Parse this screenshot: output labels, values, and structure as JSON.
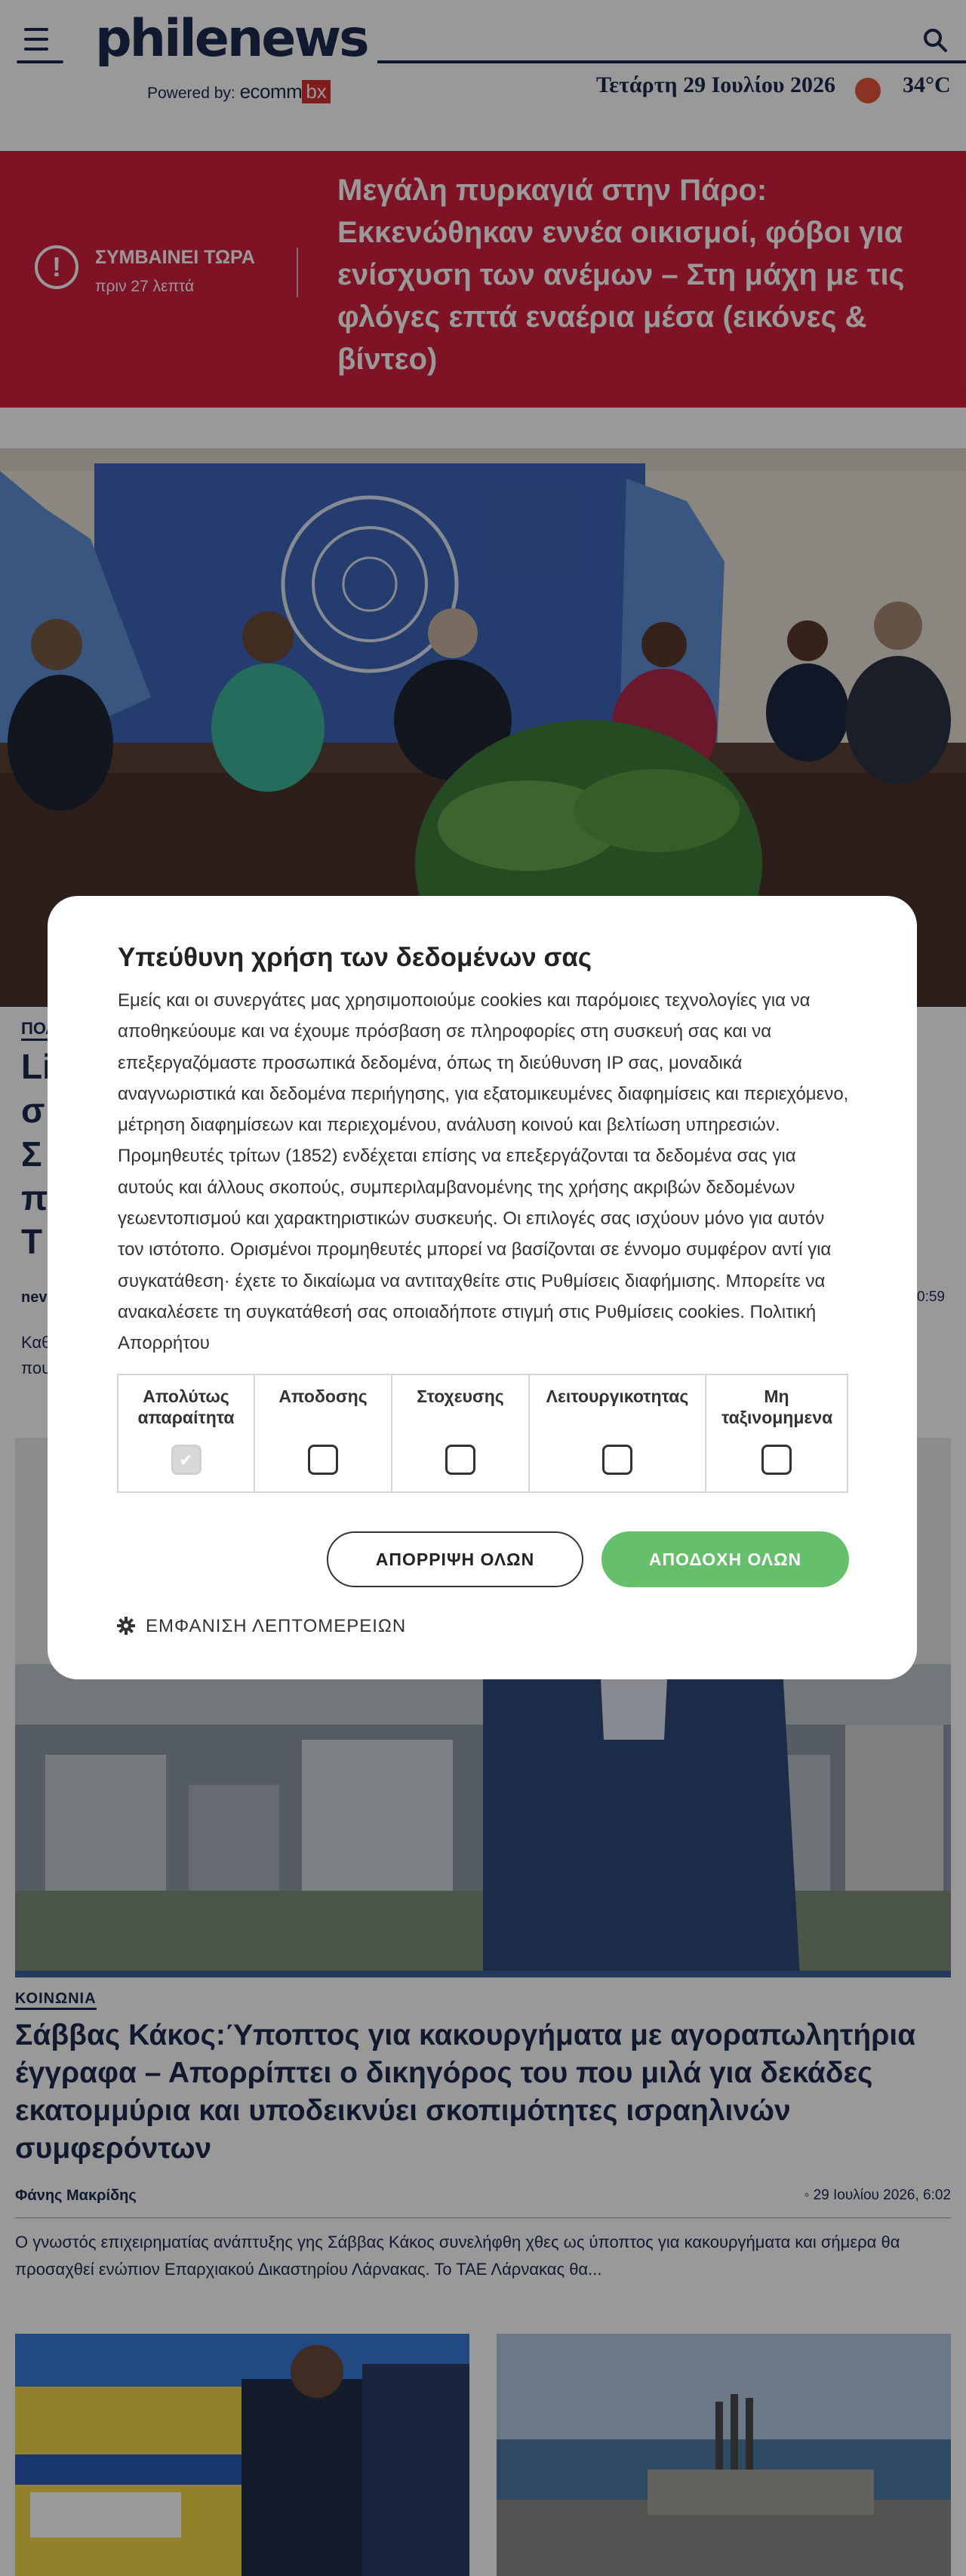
{
  "header": {
    "logo": "philenews",
    "powered_by": "Powered by:",
    "powered_brand": "ecomm",
    "powered_brand_suffix": "bx",
    "date": "Τετάρτη 29 Ιουλίου 2026",
    "temperature": "34°C",
    "icons": [
      "menu-icon",
      "search-icon",
      "weather-icon"
    ]
  },
  "breaking": {
    "label": "ΣΥΜΒΑΙΝΕΙ ΤΩΡΑ",
    "time": "πριν 27 λεπτά",
    "headline": "Μεγάλη πυρκαγιά στην Πάρο: Εκκενώθηκαν εννέα οικισμοί, φόβοι για ενίσχυση των ανέμων – Στη μάχη με τις φλόγες επτά εναέρια μέσα (εικόνες & βίντεο)",
    "accent": "#d2213f"
  },
  "article1": {
    "category": "ΠΟΛ",
    "title": "Li\nσ\nΣ\nπ\nΤ",
    "author": "nev",
    "time": "0:59",
    "excerpt": "Καθ\nπου"
  },
  "article2": {
    "category": "ΚΟΙΝΩΝΙΑ",
    "title": "Σάββας Κάκος:Ύποπτος για κακουργήματα με αγοραπωλητήρια έγγραφα – Απορρίπτει ο δικηγόρος του που μιλά για δεκάδες εκατομμύρια και υποδεικνύει σκοπιμότητες ισραηλινών συμφερόντων",
    "author": "Φάνης Μακρίδης",
    "time": "29 Ιουλίου 2026, 6:02",
    "excerpt": "Ο γνωστός επιχειρηματίας ανάπτυξης γης Σάββας Κάκος συνελήφθη χθες ως ύποπτος για κακουργήματα και σήμερα θα προσαχθεί ενώπιον Επαρχιακού Δικαστηρίου Λάρνακας. Το ΤΑΕ Λάρνακας θα..."
  },
  "cookie_modal": {
    "title": "Υπεύθυνη χρήση των δεδομένων σας",
    "body": "Εμείς και οι συνεργάτες μας χρησιμοποιούμε cookies και παρόμοιες τεχνολογίες για να αποθηκεύουμε και να έχουμε πρόσβαση σε πληροφορίες στη συσκευή σας και να επεξεργαζόμαστε προσωπικά δεδομένα, όπως τη διεύθυνση IP σας, μοναδικά αναγνωριστικά και δεδομένα περιήγησης, για εξατομικευμένες διαφημίσεις και περιεχόμενο, μέτρηση διαφημίσεων και περιεχομένου, ανάλυση κοινού και βελτίωση υπηρεσιών. Προμηθευτές τρίτων (1852) ενδέχεται επίσης να επεξεργάζονται τα δεδομένα σας για αυτούς και άλλους σκοπούς, συμπεριλαμβανομένης της χρήσης ακριβών δεδομένων γεωεντοπισμού και χαρακτηριστικών συσκευής. Οι επιλογές σας ισχύουν μόνο για αυτόν τον ιστότοπο. Ορισμένοι προμηθευτές μπορεί να βασίζονται σε έννομο συμφέρον αντί για συγκατάθεση· έχετε το δικαίωμα να αντιταχθείτε στις Ρυθμίσεις διαφήμισης. Μπορείτε να ανακαλέσετε τη συγκατάθεσή σας οποιαδήποτε στιγμή στις Ρυθμίσεις cookies.",
    "policy_link": "Πολιτική Απορρήτου",
    "categories": [
      {
        "label": "Απολύτως απαραίτητα",
        "checked": true
      },
      {
        "label": "Αποδοσης",
        "checked": false
      },
      {
        "label": "Στοχευσης",
        "checked": false
      },
      {
        "label": "Λειτουργικοτητας",
        "checked": false
      },
      {
        "label": "Μη ταξινομημενα",
        "checked": false
      }
    ],
    "reject_label": "ΑΠΟΡΡΙΨΗ ΟΛΩΝ",
    "accept_label": "ΑΠΟΔΟΧΗ ΟΛΩΝ",
    "details_label": "ΕΜΦΑΝΙΣΗ ΛΕΠΤΟΜΕΡΕΙΩΝ",
    "accept_color": "#66bf6a"
  }
}
